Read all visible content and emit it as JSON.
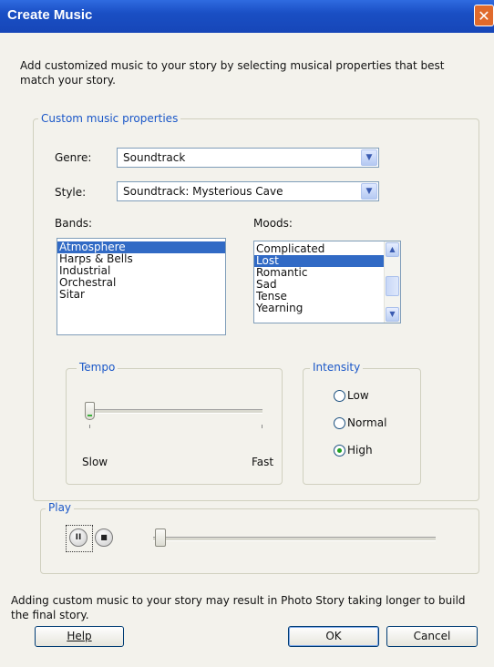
{
  "window": {
    "title": "Create Music",
    "close_glyph": "✕"
  },
  "intro_text": "Add customized music to your story by selecting musical properties that best match your story.",
  "custom": {
    "legend": "Custom music properties",
    "genre": {
      "label": "Genre:",
      "value": "Soundtrack"
    },
    "style": {
      "label": "Style:",
      "value": "Soundtrack: Mysterious Cave"
    },
    "bands": {
      "label": "Bands:",
      "items": [
        "Atmosphere",
        "Harps & Bells",
        "Industrial",
        "Orchestral",
        "Sitar"
      ],
      "selected": "Atmosphere"
    },
    "moods": {
      "label": "Moods:",
      "items": [
        "Complicated",
        "Lost",
        "Romantic",
        "Sad",
        "Tense",
        "Yearning"
      ],
      "selected": "Lost"
    },
    "tempo": {
      "legend": "Tempo",
      "slow_label": "Slow",
      "fast_label": "Fast",
      "level": 0.0
    },
    "intensity": {
      "legend": "Intensity",
      "options": [
        "Low",
        "Normal",
        "High"
      ],
      "selected": "High"
    }
  },
  "play": {
    "legend": "Play",
    "pause_glyph": "II",
    "stop_glyph": "■",
    "position": 0.02
  },
  "footer_text": "Adding custom music to your story may result in Photo Story taking longer to build the final story.",
  "buttons": {
    "help": "Help",
    "ok": "OK",
    "cancel": "Cancel"
  },
  "icons": {
    "combo_arrow": "chevron-down-icon",
    "scroll_up": "chevron-up-icon",
    "scroll_down": "chevron-down-icon"
  },
  "colors": {
    "title_bar": "#1a4fc4",
    "selection": "#316ac5",
    "legend_text": "#1a57c8",
    "close_button": "#e06a2c"
  }
}
